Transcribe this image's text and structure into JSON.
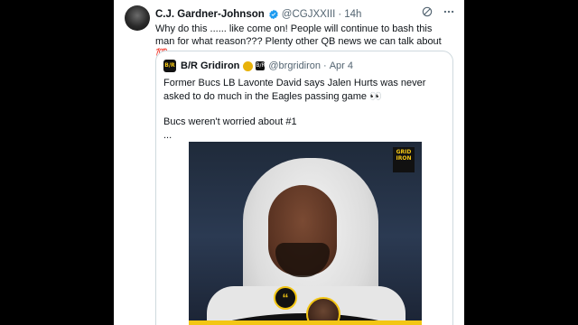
{
  "tweet": {
    "author_name": "C.J. Gardner-Johnson",
    "handle": "@CGJXXIII",
    "separator": "·",
    "time": "14h",
    "text": "Why do this ...... like come on! People will continue to bash this man for what reason??? Plenty other QB news we can talk about 💯"
  },
  "quote": {
    "author_name": "B/R Gridiron",
    "affiliate_badge": "B/R",
    "handle": "@brgridiron",
    "separator": "·",
    "date": "Apr 4",
    "line1": "Former Bucs LB Lavonte David says Jalen Hurts was never asked to do much in the Eagles passing game 👀",
    "line2": "Bucs weren't worried about #1",
    "line3": "...",
    "media_logo": "GRID IRON",
    "avatar_logo": "B/R"
  },
  "colors": {
    "verified_blue": "#1d9bf0",
    "gold": "#e8b20a",
    "brand_yellow": "#f3c614",
    "text": "#0f1419",
    "muted": "#536471"
  },
  "icons": [
    "verified-icon",
    "grok-icon",
    "more-icon",
    "gold-badge-icon",
    "quote-mark-icon"
  ]
}
